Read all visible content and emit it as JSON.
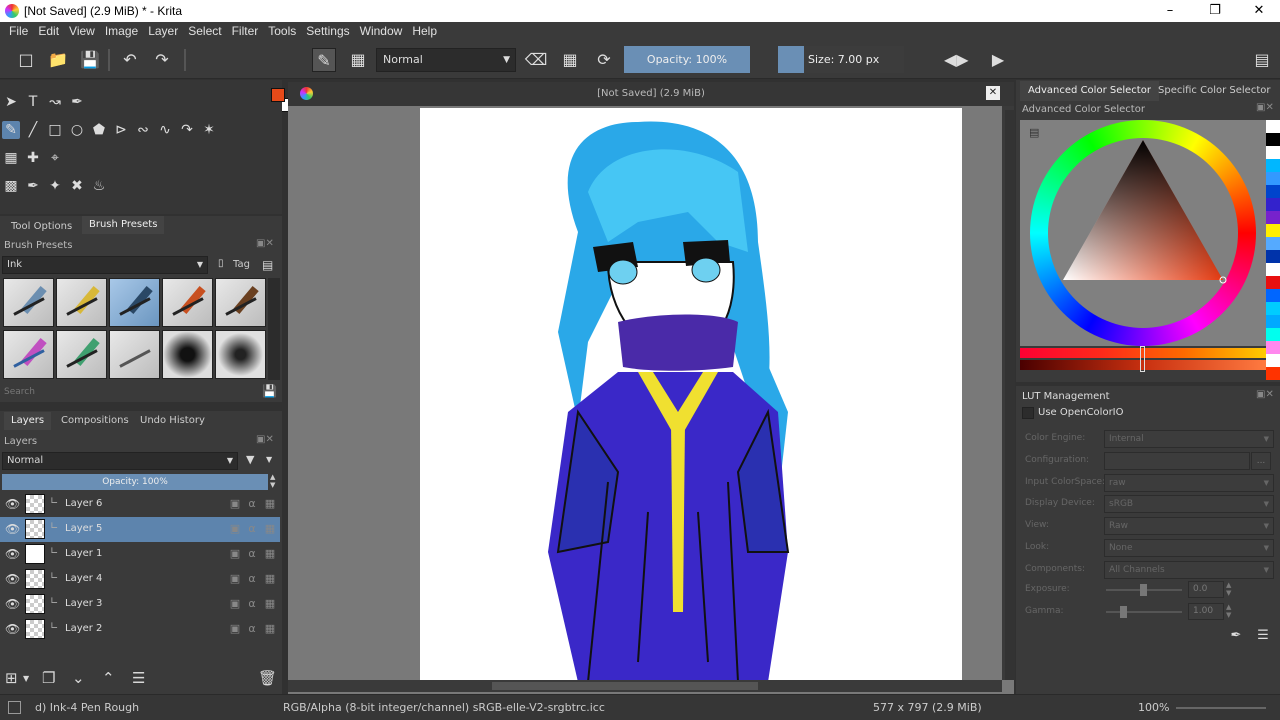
{
  "window": {
    "title": "[Not Saved]  (2.9 MiB) * - Krita"
  },
  "menu": [
    "File",
    "Edit",
    "View",
    "Image",
    "Layer",
    "Select",
    "Filter",
    "Tools",
    "Settings",
    "Window",
    "Help"
  ],
  "toolbar": {
    "blend_mode": "Normal",
    "opacity_label": "Opacity:  100%",
    "size_label": "Size:  7.00 px",
    "fg_color": "#e64a19",
    "bg_color": "#ffffff"
  },
  "left": {
    "tabs": [
      "Tool Options",
      "Brush Presets"
    ],
    "brush_presets_title": "Brush Presets",
    "brush_filter": "Ink",
    "tag_label": "Tag",
    "search_placeholder": "Search",
    "layer_tabs": [
      "Layers",
      "Compositions",
      "Undo History"
    ],
    "layers_title": "Layers",
    "layer_blend": "Normal",
    "layer_opacity": "Opacity:  100%",
    "layers": [
      {
        "name": "Layer 6",
        "selected": false,
        "thumb": "checker"
      },
      {
        "name": "Layer 5",
        "selected": true,
        "thumb": "checker"
      },
      {
        "name": "Layer 1",
        "selected": false,
        "thumb": "white"
      },
      {
        "name": "Layer 4",
        "selected": false,
        "thumb": "checker"
      },
      {
        "name": "Layer 3",
        "selected": false,
        "thumb": "checker"
      },
      {
        "name": "Layer 2",
        "selected": false,
        "thumb": "checker"
      }
    ]
  },
  "canvas": {
    "title": "[Not Saved]  (2.9 MiB)"
  },
  "right": {
    "tabs": [
      "Advanced Color Selector",
      "Specific Color Selector"
    ],
    "acs_title": "Advanced Color Selector",
    "lut_title": "LUT Management",
    "use_ocio": "Use OpenColorIO",
    "fields": [
      {
        "label": "Color Engine:",
        "value": "Internal"
      },
      {
        "label": "Configuration:",
        "value": ""
      },
      {
        "label": "Input ColorSpace:",
        "value": "raw"
      },
      {
        "label": "Display Device:",
        "value": "sRGB"
      },
      {
        "label": "View:",
        "value": "Raw"
      },
      {
        "label": "Look:",
        "value": "None"
      },
      {
        "label": "Components:",
        "value": "All Channels"
      }
    ],
    "exposure_label": "Exposure:",
    "exposure_value": "0.0",
    "gamma_label": "Gamma:",
    "gamma_value": "1.00",
    "swatches": [
      "#ffffff",
      "#000000",
      "#ffffff",
      "#00b7ff",
      "#3399ff",
      "#0044cc",
      "#3322cc",
      "#7722cc",
      "#ffee00",
      "#55aaff",
      "#0033aa",
      "#ffffff",
      "#e81010",
      "#0066ff",
      "#00ccff",
      "#00aaff",
      "#00ffee",
      "#ff88ee",
      "#ffffff",
      "#ff3300"
    ]
  },
  "status": {
    "brush": "d) Ink-4 Pen Rough",
    "colorspace": "RGB/Alpha (8-bit integer/channel)  sRGB-elle-V2-srgbtrc.icc",
    "dimensions": "577 x 797 (2.9 MiB)",
    "zoom": "100%"
  }
}
